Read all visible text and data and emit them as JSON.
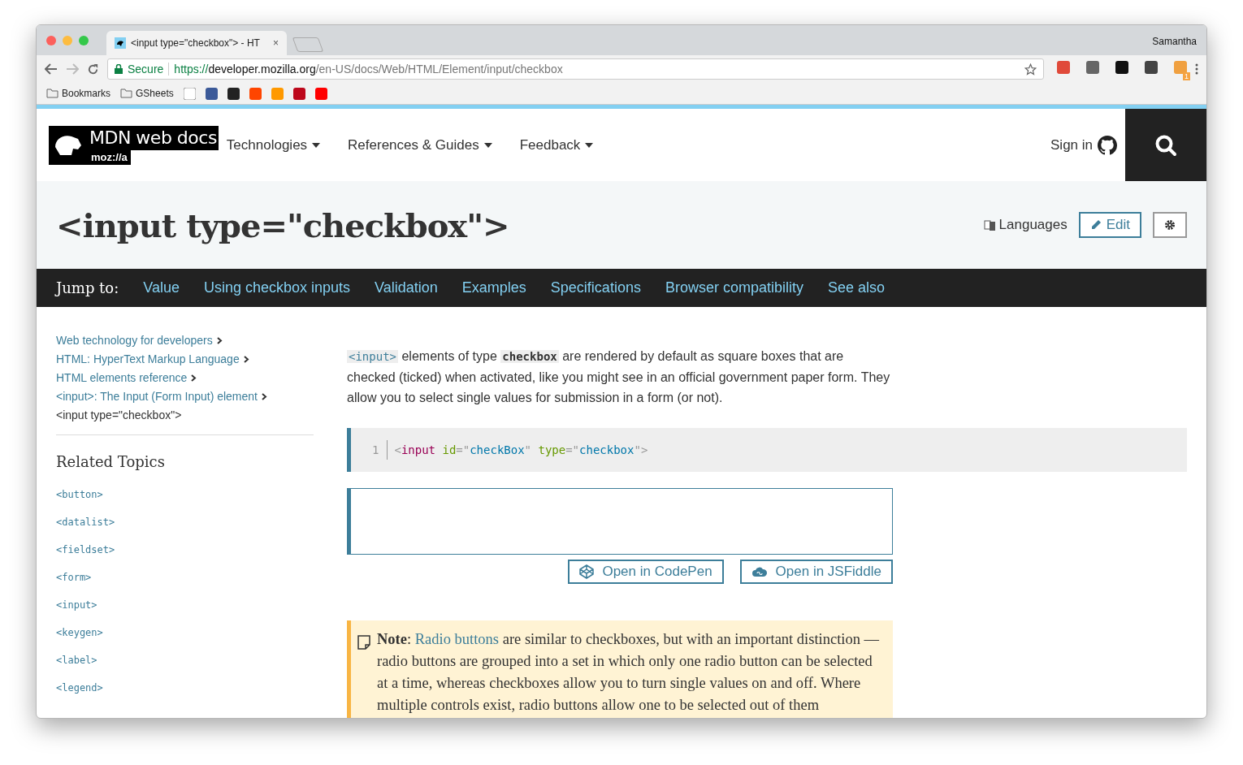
{
  "browser": {
    "tab": {
      "title": "<input type=\"checkbox\"> - HT",
      "close": "×"
    },
    "profile": "Samantha",
    "address": {
      "secure_label": "Secure",
      "scheme": "https://",
      "host": "developer.mozilla.org",
      "path": "/en-US/docs/Web/HTML/Element/input/checkbox"
    },
    "bookmarks": [
      {
        "kind": "folder",
        "label": "Bookmarks"
      },
      {
        "kind": "folder",
        "label": "GSheets"
      },
      {
        "kind": "site",
        "color": "#ffffff"
      },
      {
        "kind": "site",
        "color": "#3b5998"
      },
      {
        "kind": "site",
        "color": "#222222"
      },
      {
        "kind": "site",
        "color": "#ff4500"
      },
      {
        "kind": "site",
        "color": "#ff9900"
      },
      {
        "kind": "site",
        "color": "#bd081c"
      },
      {
        "kind": "site",
        "color": "#ff0000"
      }
    ],
    "extensions": [
      {
        "color": "#e04a3a"
      },
      {
        "color": "#666666"
      },
      {
        "color": "#111111"
      },
      {
        "color": "#444444"
      },
      {
        "color": "#f0a040",
        "badge": "1"
      }
    ]
  },
  "header": {
    "logo": {
      "title": "MDN web docs",
      "subtitle": "moz://a"
    },
    "nav": [
      "Technologies",
      "References & Guides",
      "Feedback"
    ],
    "sign_in": "Sign in"
  },
  "title_band": {
    "title": "<input type=\"checkbox\">",
    "languages": "Languages",
    "edit": "Edit"
  },
  "jump_bar": {
    "label": "Jump to:",
    "links": [
      "Value",
      "Using checkbox inputs",
      "Validation",
      "Examples",
      "Specifications",
      "Browser compatibility",
      "See also"
    ]
  },
  "sidebar": {
    "breadcrumbs": [
      {
        "label": "Web technology for developers",
        "current": false
      },
      {
        "label": "HTML: HyperText Markup Language",
        "current": false
      },
      {
        "label": "HTML elements reference",
        "current": false
      },
      {
        "label": "<input>: The Input (Form Input) element",
        "current": false
      },
      {
        "label": "<input type=\"checkbox\">",
        "current": true
      }
    ],
    "related_heading": "Related Topics",
    "topics": [
      "<button>",
      "<datalist>",
      "<fieldset>",
      "<form>",
      "<input>",
      "<keygen>",
      "<label>",
      "<legend>"
    ]
  },
  "main": {
    "intro": [
      {
        "kind": "link-code",
        "text": "<input>"
      },
      {
        "kind": "text",
        "text": " elements of type "
      },
      {
        "kind": "code",
        "text": "checkbox"
      },
      {
        "kind": "text",
        "text": " are rendered by default as square boxes that are checked (ticked) when activated, like you might see in an official government paper form. They allow you to select single values for submission in a form (or not)."
      }
    ],
    "code": {
      "line_number": "1",
      "tokens": [
        {
          "kind": "punct",
          "text": "<"
        },
        {
          "kind": "tag",
          "text": "input"
        },
        {
          "kind": "attr",
          "text": "id"
        },
        {
          "kind": "punct",
          "text": "=\""
        },
        {
          "kind": "string",
          "text": "checkBox"
        },
        {
          "kind": "punct",
          "text": "\""
        },
        {
          "kind": "attr",
          "text": "type"
        },
        {
          "kind": "punct",
          "text": "=\""
        },
        {
          "kind": "string",
          "text": "checkbox"
        },
        {
          "kind": "punct",
          "text": "\">"
        }
      ]
    },
    "buttons": [
      {
        "kind": "codepen",
        "label": "Open in CodePen"
      },
      {
        "kind": "jsfiddle",
        "label": "Open in JSFiddle"
      }
    ],
    "note": {
      "lead": "**Note**: ",
      "link": "Radio buttons",
      "text": " are similar to checkboxes, but with an important distinction — radio buttons are grouped into a set in which only one radio button can be selected at a time, whereas checkboxes allow you to turn single values on and off. Where multiple controls exist, radio buttons allow one to be selected out of them"
    }
  }
}
